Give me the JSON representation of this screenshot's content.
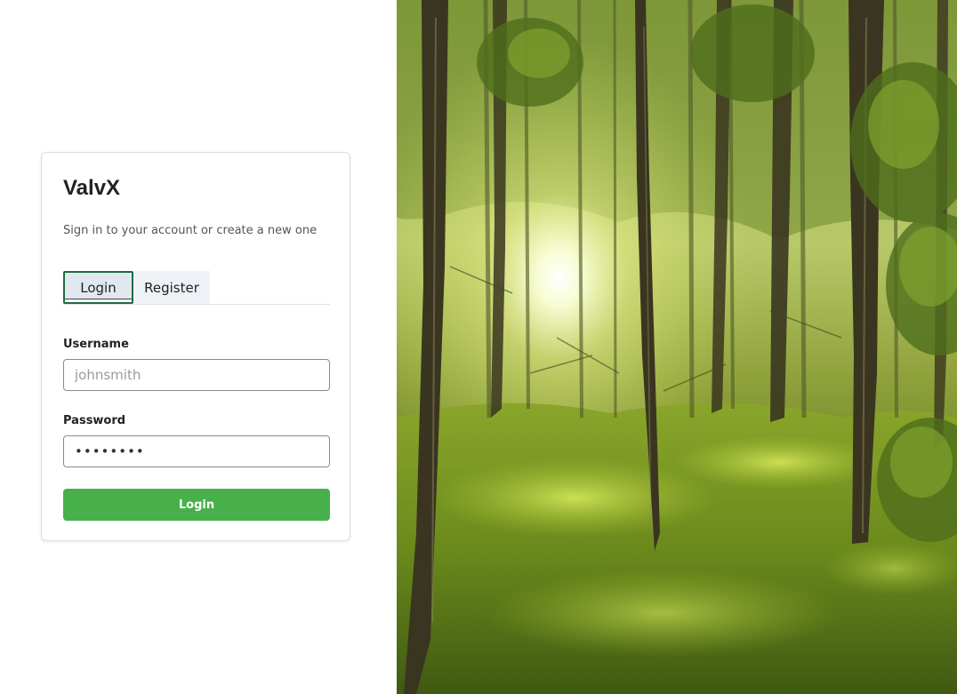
{
  "app": {
    "title": "ValvX",
    "subtitle": "Sign in to your account or create a new one"
  },
  "tabs": [
    {
      "label": "Login",
      "active": true
    },
    {
      "label": "Register",
      "active": false
    }
  ],
  "form": {
    "username_label": "Username",
    "username_placeholder": "johnsmith",
    "password_label": "Password",
    "password_value": "••••••••",
    "submit_label": "Login"
  },
  "hero_image": {
    "subject": "forest-with-sunlight"
  },
  "colors": {
    "accent": "#47b04b",
    "tab_active_border": "#1f6b43",
    "tab_bg": "#e1e8f0"
  }
}
